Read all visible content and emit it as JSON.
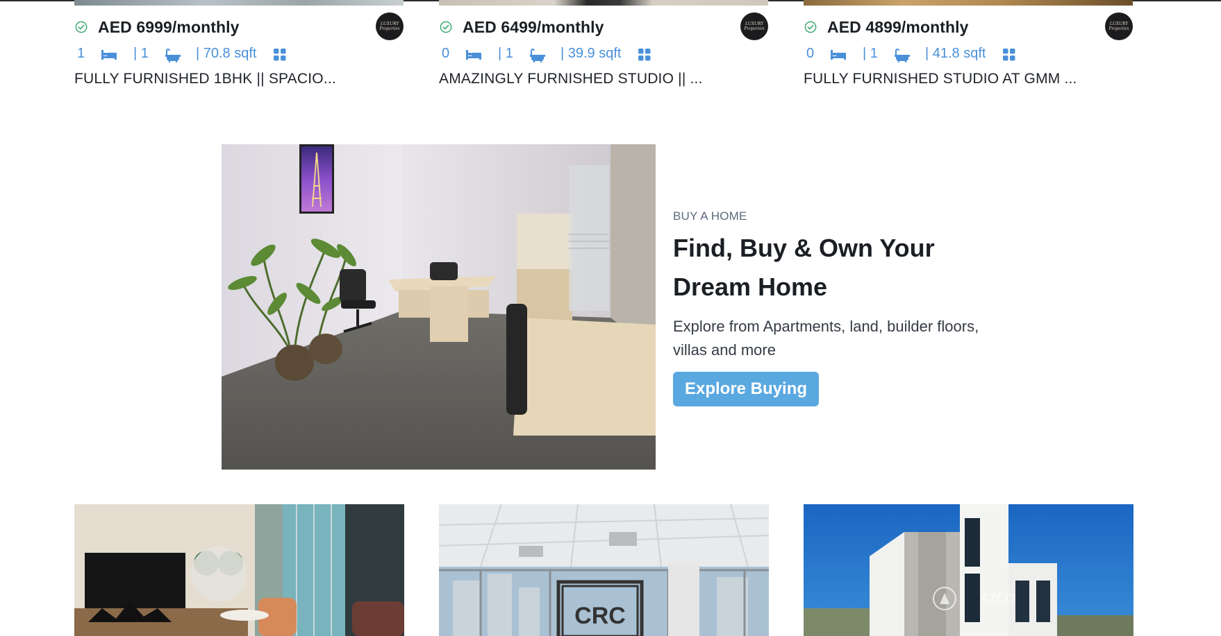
{
  "listings": [
    {
      "price": "AED 6999/monthly",
      "beds": "1",
      "baths": "| 1",
      "area": "| 70.8 sqft",
      "title": "FULLY FURNISHED 1BHK || SPACIO..."
    },
    {
      "price": "AED 6499/monthly",
      "beds": "0",
      "baths": "| 1",
      "area": "| 39.9 sqft",
      "title": "AMAZINGLY FURNISHED STUDIO || ..."
    },
    {
      "price": "AED 4899/monthly",
      "beds": "0",
      "baths": "| 1",
      "area": "| 41.8 sqft",
      "title": "FULLY FURNISHED STUDIO AT GMM ..."
    }
  ],
  "promo": {
    "eyebrow": "BUY A HOME",
    "headline": "Find, Buy & Own Your Dream Home",
    "description": "Explore from Apartments, land, builder floors, villas and more",
    "button_label": "Explore Buying"
  },
  "bottom_cards": [
    {
      "image": "furnished-living-room-photo"
    },
    {
      "image": "office-interior-photo",
      "watermark": "CRC"
    },
    {
      "image": "modern-villa-exterior-photo",
      "watermark": "AZCO"
    }
  ],
  "icons": [
    "verified-check-icon",
    "agency-logo-icon",
    "bed-icon",
    "bath-icon",
    "grid-icon"
  ],
  "colors": {
    "accent": "#4a90d9",
    "button": "#5aa8e0",
    "verified": "#3aa86b",
    "text": "#1b1f24"
  }
}
